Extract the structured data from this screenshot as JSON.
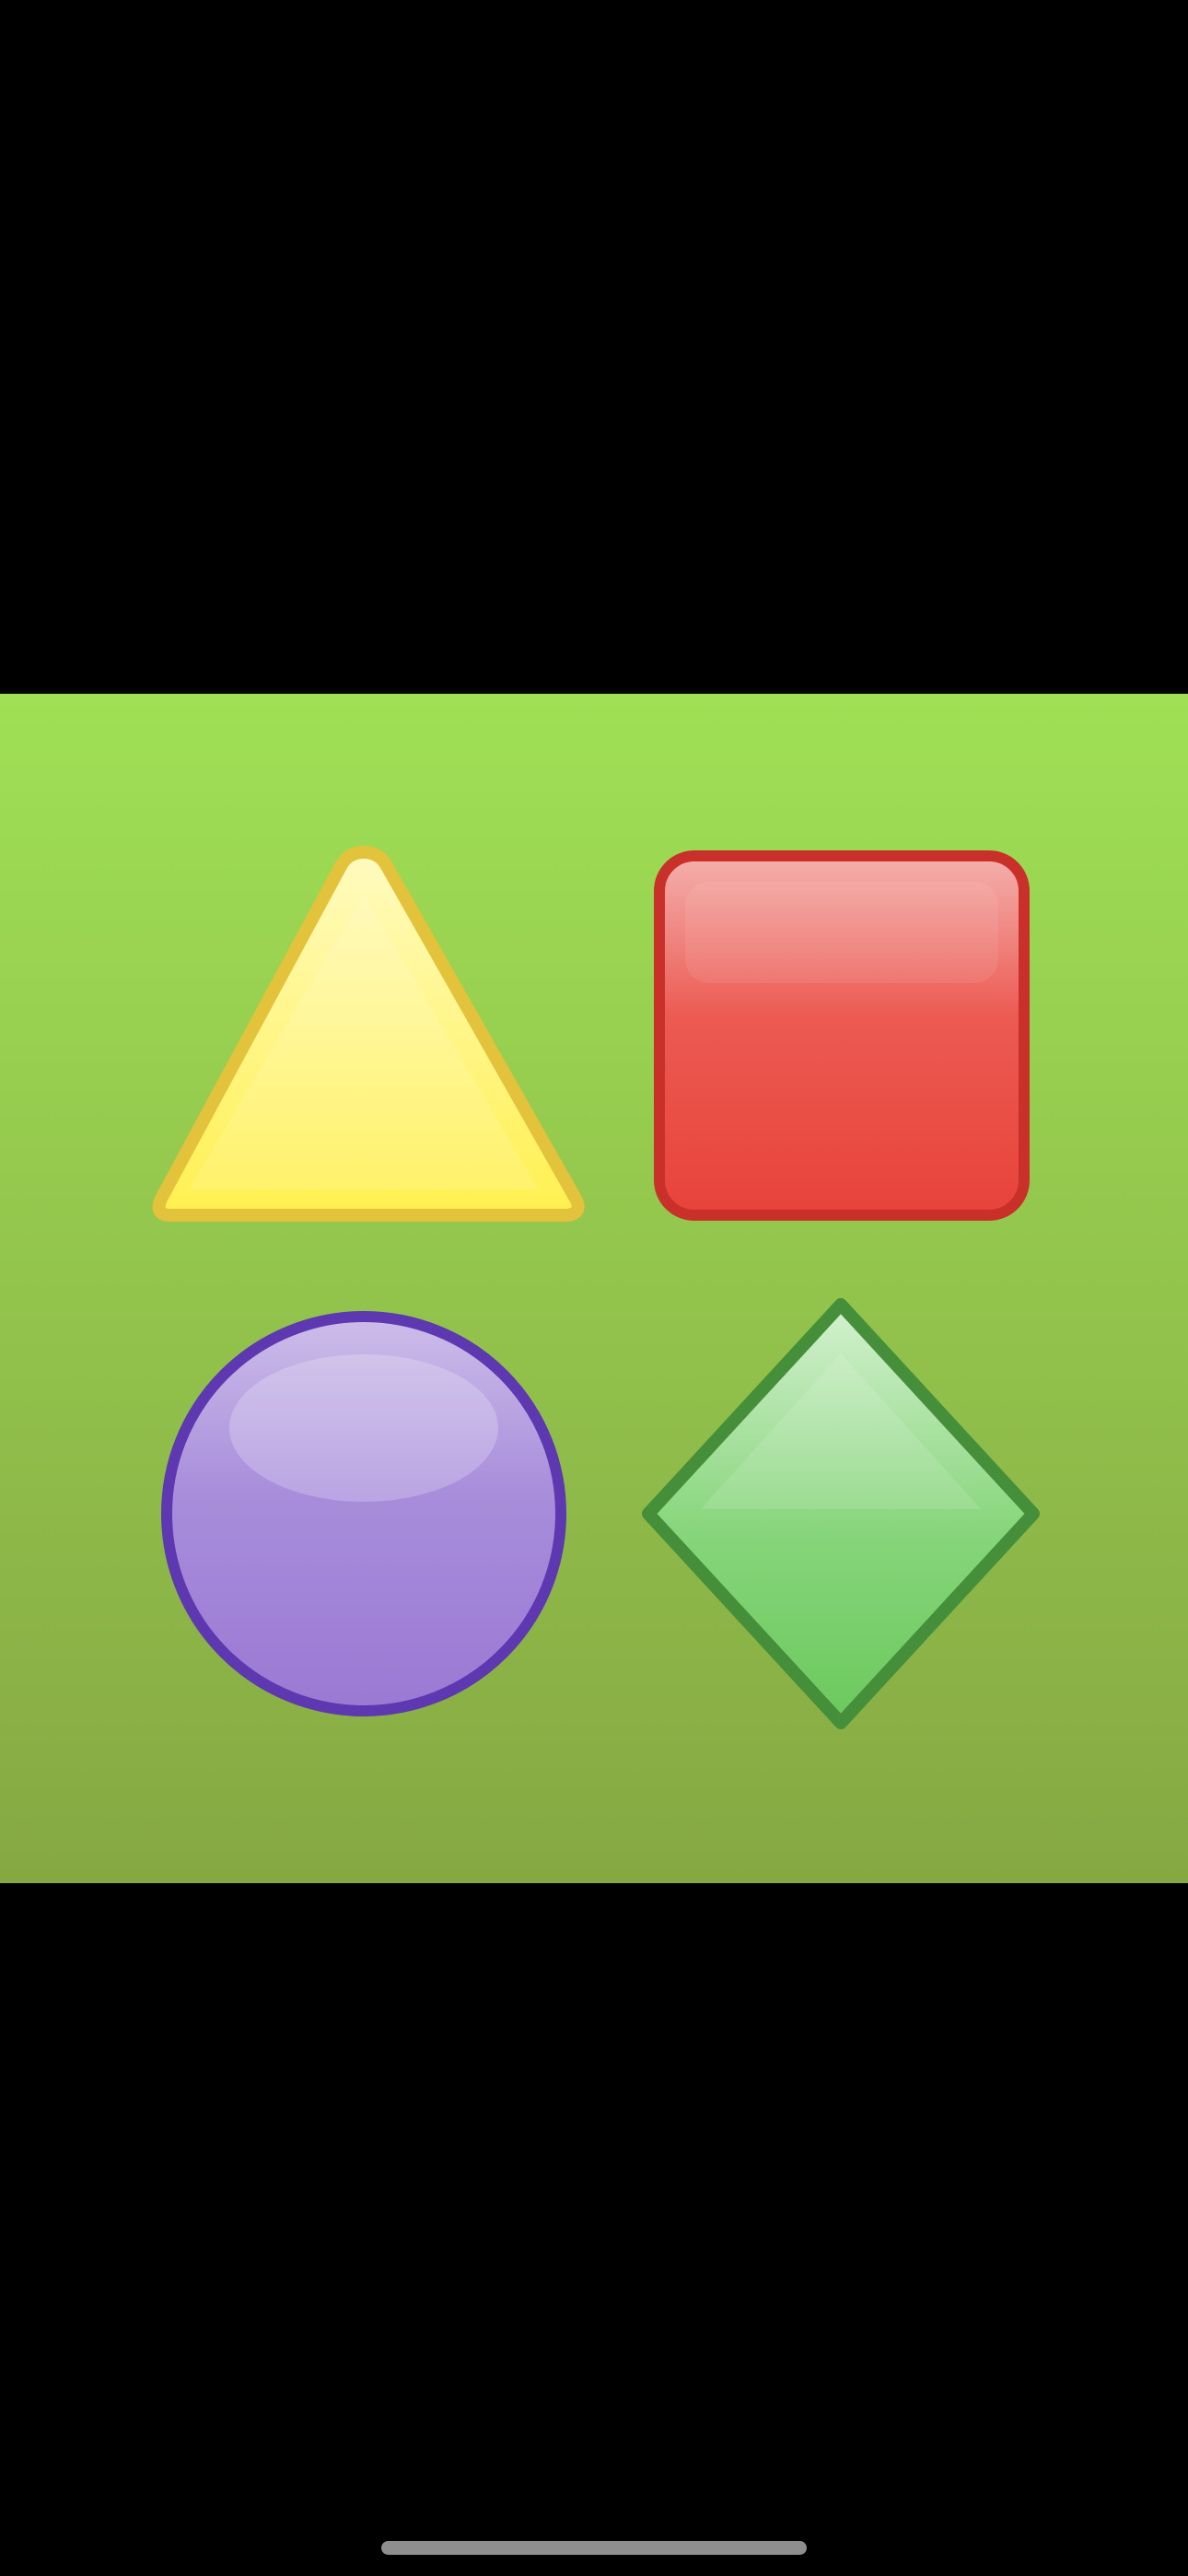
{
  "screen": {
    "background": "#000000"
  },
  "image": {
    "background_top": "#9fe055",
    "background_bottom": "#86a843",
    "shapes": [
      {
        "name": "triangle",
        "fill": "#fff36a",
        "stroke": "#e3c23c"
      },
      {
        "name": "rounded-square",
        "fill": "#eb4b42",
        "stroke": "#c9302a"
      },
      {
        "name": "circle",
        "fill": "#a485d8",
        "stroke": "#5d38b0"
      },
      {
        "name": "diamond",
        "fill": "#7fd36a",
        "stroke": "#468f3a"
      }
    ]
  },
  "system": {
    "home_indicator_color": "#8e8e8e"
  }
}
